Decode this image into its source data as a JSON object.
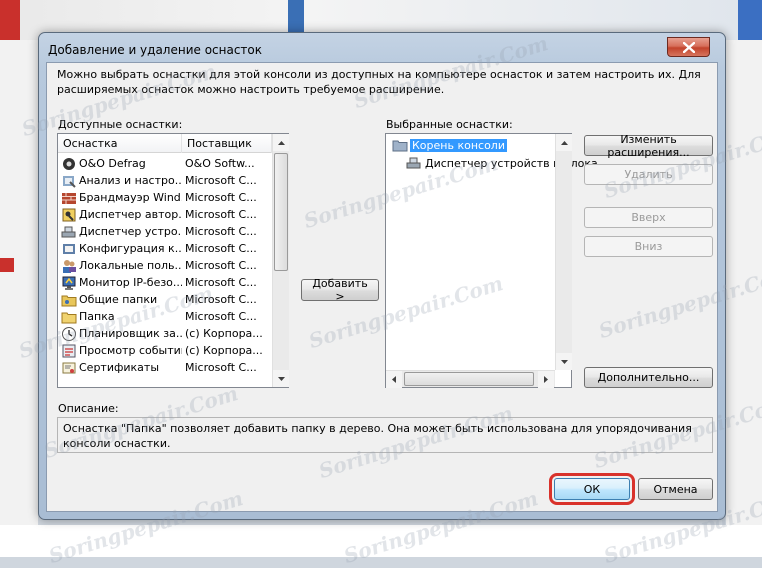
{
  "window": {
    "title": "Добавление и удаление оснасток",
    "description": "Можно выбрать оснастки для этой консоли из доступных на компьютере оснасток и затем настроить их. Для расширяемых оснасток можно настроить требуемое расширение."
  },
  "available": {
    "label": "Доступные оснастки:",
    "columns": [
      "Оснастка",
      "Поставщик"
    ],
    "items": [
      {
        "name": "O&O Defrag",
        "vendor": "O&O Softw...",
        "icon": "defrag-icon"
      },
      {
        "name": "Анализ и настро...",
        "vendor": "Microsoft C...",
        "icon": "security-analysis-icon"
      },
      {
        "name": "Брандмауэр Wind...",
        "vendor": "Microsoft C...",
        "icon": "firewall-icon"
      },
      {
        "name": "Диспетчер автор...",
        "vendor": "Microsoft C...",
        "icon": "authorization-manager-icon"
      },
      {
        "name": "Диспетчер устро...",
        "vendor": "Microsoft C...",
        "icon": "device-manager-icon"
      },
      {
        "name": "Конфигурация к...",
        "vendor": "Microsoft C...",
        "icon": "configuration-icon"
      },
      {
        "name": "Локальные поль...",
        "vendor": "Microsoft C...",
        "icon": "local-users-icon"
      },
      {
        "name": "Монитор IP-безо...",
        "vendor": "Microsoft C...",
        "icon": "ip-security-monitor-icon"
      },
      {
        "name": "Общие папки",
        "vendor": "Microsoft C...",
        "icon": "shared-folders-icon"
      },
      {
        "name": "Папка",
        "vendor": "Microsoft C...",
        "icon": "folder-icon"
      },
      {
        "name": "Планировщик за...",
        "vendor": "(c) Корпора...",
        "icon": "task-scheduler-icon"
      },
      {
        "name": "Просмотр событий",
        "vendor": "(c) Корпора...",
        "icon": "event-viewer-icon"
      },
      {
        "name": "Сертификаты",
        "vendor": "Microsoft C...",
        "icon": "certificates-icon"
      }
    ]
  },
  "add_button": "Добавить >",
  "selected": {
    "label": "Выбранные оснастки:",
    "root": "Корень консоли",
    "child": "Диспетчер устройств на лока"
  },
  "buttons": {
    "edit_extensions": "Изменить расширения...",
    "remove": "Удалить",
    "move_up": "Вверх",
    "move_down": "Вниз",
    "advanced": "Дополнительно...",
    "ok": "ОК",
    "cancel": "Отмена"
  },
  "description_box": {
    "label": "Описание:",
    "text": "Оснастка \"Папка\" позволяет добавить папку в дерево. Она может быть использована для упорядочивания консоли оснастки."
  },
  "watermark": "Sоringрeрair.Com",
  "colors": {
    "selection": "#3399ff",
    "ok_highlight": "#d9322b",
    "close_button": "#c2432c"
  }
}
